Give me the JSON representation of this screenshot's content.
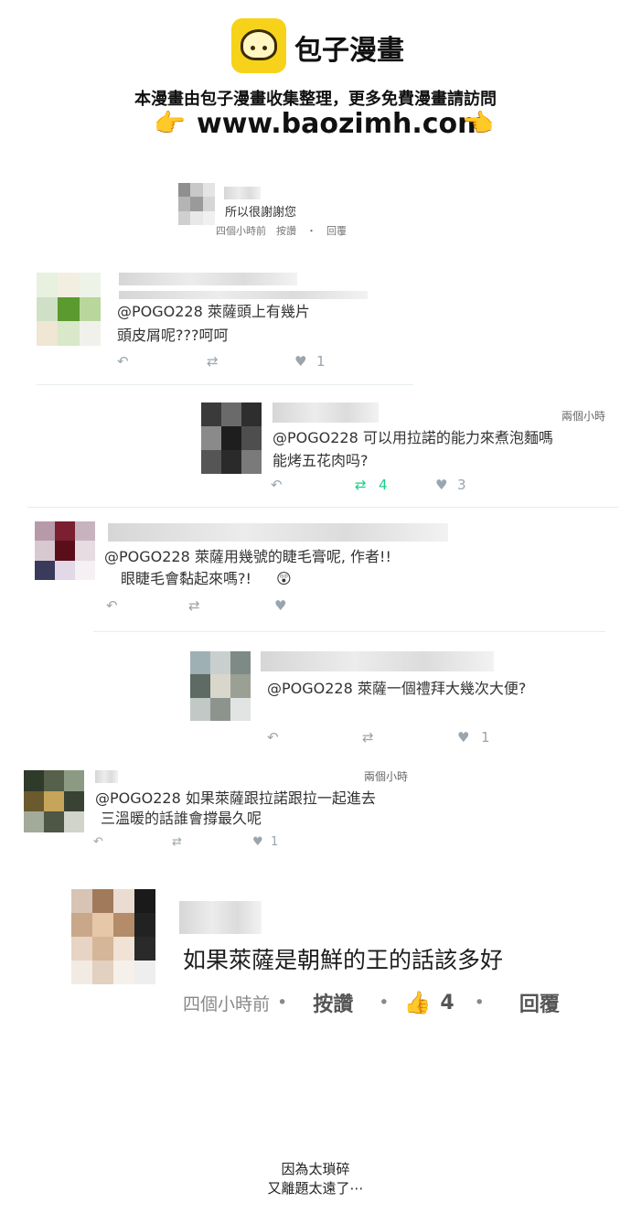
{
  "banner": {
    "brand": "包子漫畫",
    "notice": "本漫畫由包子漫畫收集整理，更多免費漫畫請訪問",
    "url": "www.baozimh.com",
    "hand_icon": "pointing-hand-icon",
    "accent": "#f7d21b"
  },
  "comments": [
    {
      "text": "所以很謝謝您",
      "meta": "四個小時前　按讚　・　回覆"
    },
    {
      "line1": "@POGO228 萊薩頭上有幾片",
      "line2": "頭皮屑呢???呵呵",
      "likes": "1"
    },
    {
      "time": "兩個小時",
      "line1": "@POGO228  可以用拉諾的能力來煮泡麵嗎",
      "line2": "能烤五花肉吗?",
      "retweets": "4",
      "likes": "3"
    },
    {
      "line1": "@POGO228 萊薩用幾號的睫毛膏呢, 作者!!",
      "line2": "眼睫毛會黏起來嗎?!",
      "emoji": "😲"
    },
    {
      "line1": "@POGO228 萊薩一個禮拜大幾次大便?",
      "likes": "1"
    },
    {
      "time": "兩個小時",
      "line1": "@POGO228  如果萊薩跟拉諾跟拉一起進去",
      "line2": "三溫暖的話誰會撐最久呢",
      "likes": "1"
    },
    {
      "text": "如果萊薩是朝鮮的王的話該多好",
      "time": "四個小時前",
      "like_label": "按讚",
      "like_count": "4",
      "reply_label": "回覆"
    }
  ],
  "footer": {
    "line1": "因為太瑣碎",
    "line2": "又離題太遠了⋯"
  },
  "icons": {
    "reply": "reply-icon",
    "retweet": "retweet-icon",
    "like": "heart-icon",
    "thumbs_up": "thumbs-up-icon"
  },
  "colors": {
    "retweet_active": "#19cf86",
    "action_grey": "#9aa5ad"
  }
}
